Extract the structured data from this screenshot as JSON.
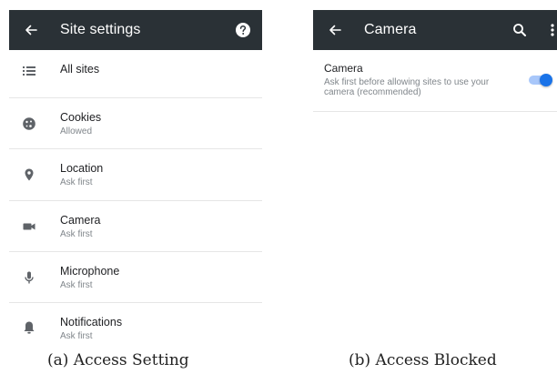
{
  "panel_a": {
    "title": "Site settings",
    "items": [
      {
        "icon": "list-icon",
        "title": "All sites",
        "subtitle": ""
      },
      {
        "icon": "cookie-icon",
        "title": "Cookies",
        "subtitle": "Allowed"
      },
      {
        "icon": "location-pin-icon",
        "title": "Location",
        "subtitle": "Ask first"
      },
      {
        "icon": "video-camera-icon",
        "title": "Camera",
        "subtitle": "Ask first"
      },
      {
        "icon": "microphone-icon",
        "title": "Microphone",
        "subtitle": "Ask first"
      },
      {
        "icon": "bell-icon",
        "title": "Notifications",
        "subtitle": "Ask first"
      }
    ]
  },
  "panel_b": {
    "title": "Camera",
    "setting": {
      "title": "Camera",
      "description": "Ask first before allowing sites to use your camera (recommended)",
      "enabled": true
    }
  },
  "captions": {
    "a": "(a) Access Setting",
    "b": "(b) Access Blocked"
  },
  "colors": {
    "appbar": "#2a3136",
    "toggle_on": "#1a73e8",
    "toggle_track": "#a8c7fa"
  }
}
